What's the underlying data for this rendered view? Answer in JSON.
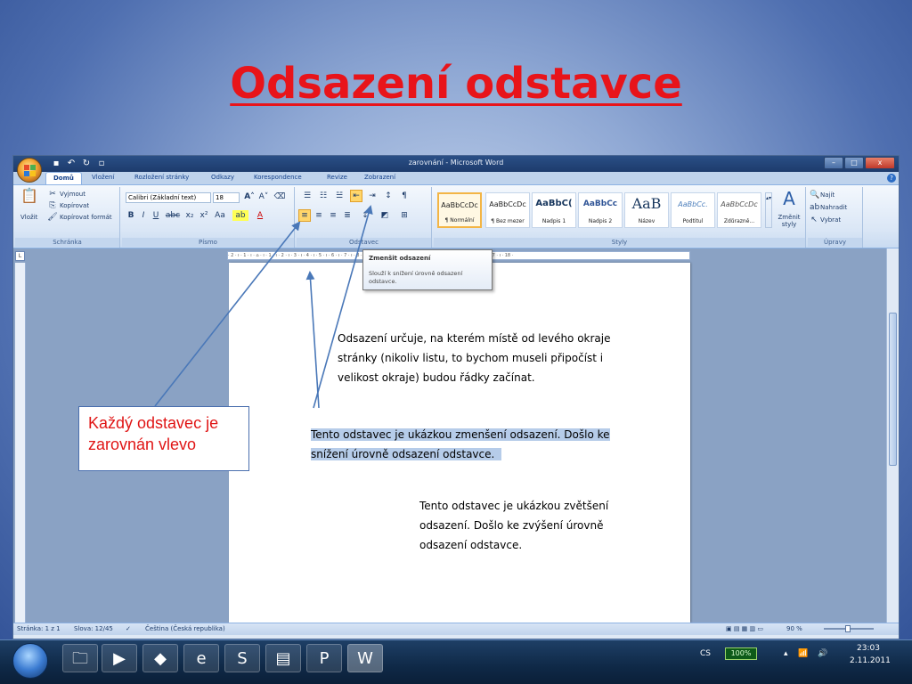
{
  "slide": {
    "title": "Odsazení odstavce",
    "callout_text": "Každý odstavec je zarovnán vlevo"
  },
  "window": {
    "title": "zarovnání - Microsoft Word",
    "controls": [
      "–",
      "□",
      "x"
    ]
  },
  "tabs": [
    {
      "label": "Domů",
      "active": true
    },
    {
      "label": "Vložení"
    },
    {
      "label": "Rozložení stránky"
    },
    {
      "label": "Odkazy"
    },
    {
      "label": "Korespondence"
    },
    {
      "label": "Revize"
    },
    {
      "label": "Zobrazení"
    }
  ],
  "ribbon": {
    "clipboard": {
      "label": "Schránka",
      "paste": "Vložit",
      "cut": "Vyjmout",
      "copy": "Kopírovat",
      "format_painter": "Kopírovat formát"
    },
    "font": {
      "label": "Písmo",
      "family": "Calibri (Základní text)",
      "size": "18"
    },
    "paragraph": {
      "label": "Odstavec"
    },
    "styles": {
      "label": "Styly",
      "items": [
        {
          "sample": "AaBbCcDc",
          "name": "¶ Normální",
          "selected": true
        },
        {
          "sample": "AaBbCcDc",
          "name": "¶ Bez mezer"
        },
        {
          "sample": "AaBbC(",
          "name": "Nadpis 1"
        },
        {
          "sample": "AaBbCc",
          "name": "Nadpis 2"
        },
        {
          "sample": "AaB",
          "name": "Název"
        },
        {
          "sample": "AaBbCc.",
          "name": "Podtitul"
        },
        {
          "sample": "AaBbCcDc",
          "name": "Zdůrazně..."
        }
      ],
      "change_styles": "Změnit styly"
    },
    "editing": {
      "label": "Úpravy",
      "find": "Najít",
      "replace": "Nahradit",
      "select": "Vybrat"
    }
  },
  "tooltip": {
    "title": "Zmenšit odsazení",
    "description": "Slouží k snížení úrovně odsazení odstavce."
  },
  "document": {
    "paragraphs": [
      "Odsazení určuje, na kterém místě od levého okraje stránky (nikoliv listu, to bychom museli připočíst i velikost okraje) budou řádky začínat.",
      "Tento odstavec je ukázkou zmenšení odsazení. Došlo ke snížení úrovně odsazení odstavce.",
      "Tento odstavec je ukázkou zvětšení odsazení. Došlo ke zvýšení úrovně odsazení odstavce."
    ],
    "paragraph_lines": [
      [
        "Odsazení určuje, na kterém místě od levého okraje",
        "stránky (nikoliv listu, to bychom museli připočíst i",
        "velikost okraje) budou řádky začínat."
      ],
      [
        "Tento odstavec je ukázkou zmenšení odsazení. Došlo ke",
        "snížení úrovně odsazení odstavce."
      ],
      [
        "Tento odstavec je ukázkou zvětšení",
        "odsazení. Došlo ke zvýšení úrovně",
        "odsazení odstavce."
      ]
    ]
  },
  "statusbar": {
    "page": "Stránka: 1 z 1",
    "words": "Slova: 12/45",
    "language": "Čeština (Česká republika)",
    "zoom": "90 %"
  },
  "taskbar": {
    "language": "CS",
    "battery": "100%",
    "time": "23:03",
    "date": "2.11.2011"
  },
  "colors": {
    "title_red": "#e8141a",
    "callout_red": "#e01515",
    "highlight": "#b6cce9",
    "arrow": "#4a78b8"
  }
}
